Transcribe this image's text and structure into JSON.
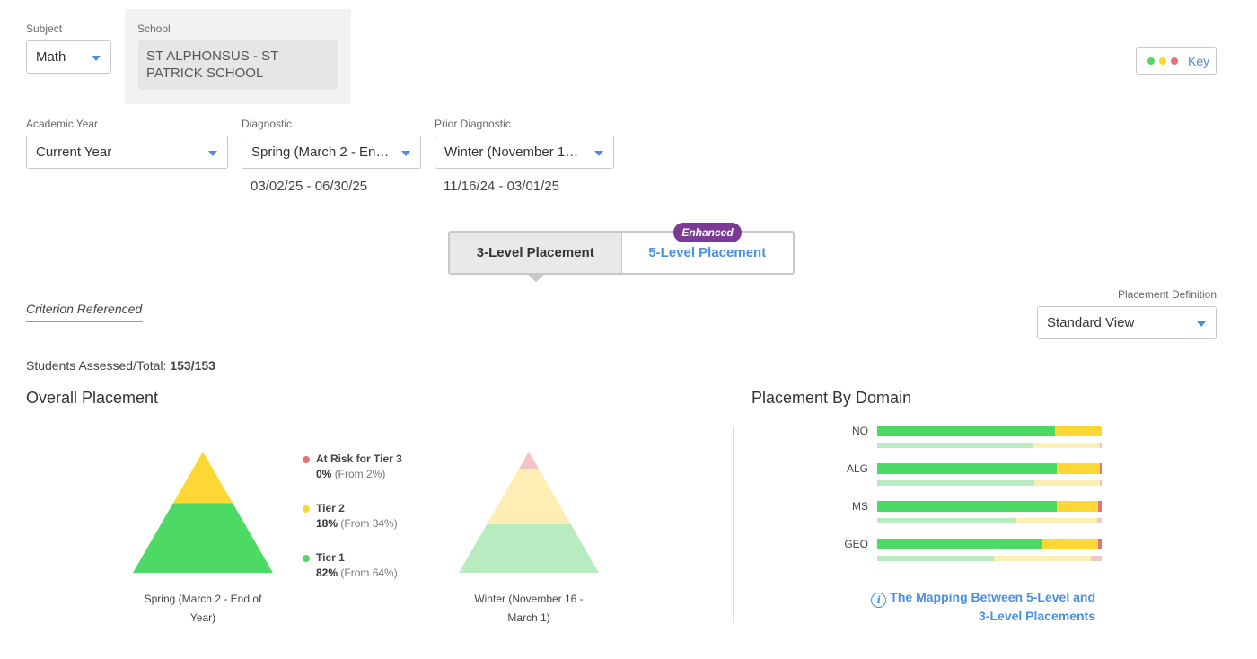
{
  "filters": {
    "subject": {
      "label": "Subject",
      "value": "Math"
    },
    "school": {
      "label": "School",
      "value": "ST ALPHONSUS - ST PATRICK SCHOOL"
    },
    "academic_year": {
      "label": "Academic Year",
      "value": "Current Year"
    },
    "diagnostic": {
      "label": "Diagnostic",
      "value": "Spring (March 2 - End of Year)",
      "dates": "03/02/25 - 06/30/25"
    },
    "prior_diagnostic": {
      "label": "Prior Diagnostic",
      "value": "Winter (November 16 - March 1)",
      "dates": "11/16/24 - 03/01/25"
    }
  },
  "key_button": {
    "label": "Key",
    "dots": [
      "#4cd964",
      "#fdd835",
      "#e57373"
    ]
  },
  "placement_toggle": {
    "tab_3": "3-Level Placement",
    "tab_5": "5-Level Placement",
    "badge": "Enhanced"
  },
  "criterion_label": "Criterion Referenced",
  "placement_definition": {
    "label": "Placement Definition",
    "value": "Standard View"
  },
  "students": {
    "label": "Students Assessed/Total:",
    "value": "153/153"
  },
  "overall": {
    "title": "Overall Placement",
    "current_caption": "Spring (March 2 - End of Year)",
    "prior_caption": "Winter (November 16 - March 1)",
    "legend": [
      {
        "name": "At Risk for Tier 3",
        "pct": "0%",
        "from": "(From 2%)",
        "color": "#e57373"
      },
      {
        "name": "Tier 2",
        "pct": "18%",
        "from": "(From 34%)",
        "color": "#fdd835"
      },
      {
        "name": "Tier 1",
        "pct": "82%",
        "from": "(From 64%)",
        "color": "#4cd964"
      }
    ],
    "current": {
      "tier3": 0,
      "tier2": 18,
      "tier1": 82
    },
    "prior": {
      "tier3": 2,
      "tier2": 34,
      "tier1": 64
    }
  },
  "domain": {
    "title": "Placement By Domain",
    "rows": [
      {
        "code": "NO",
        "current": [
          79,
          21,
          0
        ],
        "prior": [
          69,
          30,
          1
        ]
      },
      {
        "code": "ALG",
        "current": [
          80,
          19,
          1
        ],
        "prior": [
          70,
          29,
          1
        ]
      },
      {
        "code": "MS",
        "current": [
          80,
          18.5,
          1.5
        ],
        "prior": [
          62,
          36,
          2
        ]
      },
      {
        "code": "GEO",
        "current": [
          73,
          25.5,
          1.5
        ],
        "prior": [
          52,
          43,
          5
        ]
      }
    ],
    "colors": {
      "current": [
        "#4cd964",
        "#fdd835",
        "#e57373"
      ],
      "prior": [
        "#b8ecc0",
        "#fdeeb3",
        "#f4c4c4"
      ]
    },
    "link_line1": "The Mapping Between 5-Level and",
    "link_line2": "3-Level Placements"
  }
}
